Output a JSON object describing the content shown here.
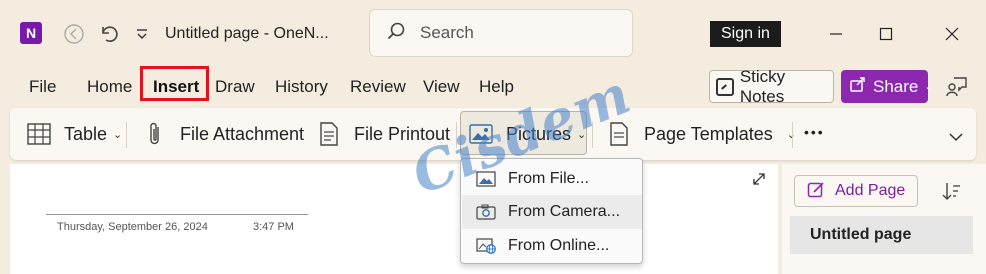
{
  "titlebar": {
    "app_logo": "N",
    "title": "Untitled page  -  OneN...",
    "search_placeholder": "Search",
    "sign_in": "Sign in"
  },
  "menu": {
    "items": [
      {
        "label": "File"
      },
      {
        "label": "Home"
      },
      {
        "label": "Insert",
        "active": true
      },
      {
        "label": "Draw"
      },
      {
        "label": "History"
      },
      {
        "label": "Review"
      },
      {
        "label": "View"
      },
      {
        "label": "Help"
      }
    ],
    "sticky_notes": "Sticky Notes",
    "share": "Share"
  },
  "ribbon": {
    "table": "Table",
    "file_attachment": "File Attachment",
    "file_printout": "File Printout",
    "pictures": "Pictures",
    "page_templates": "Page Templates",
    "more": "•••"
  },
  "pictures_menu": {
    "items": [
      "From File...",
      "From Camera...",
      "From Online..."
    ],
    "hover_index": 1
  },
  "page": {
    "date": "Thursday, September 26, 2024",
    "time": "3:47 PM"
  },
  "sidebar": {
    "add_page": "Add Page",
    "pages": [
      "Untitled page"
    ]
  },
  "watermark": "Cisdem",
  "colors": {
    "accent": "#8c27b0",
    "highlight_box": "#e1141e",
    "background": "#f3ecdf"
  }
}
